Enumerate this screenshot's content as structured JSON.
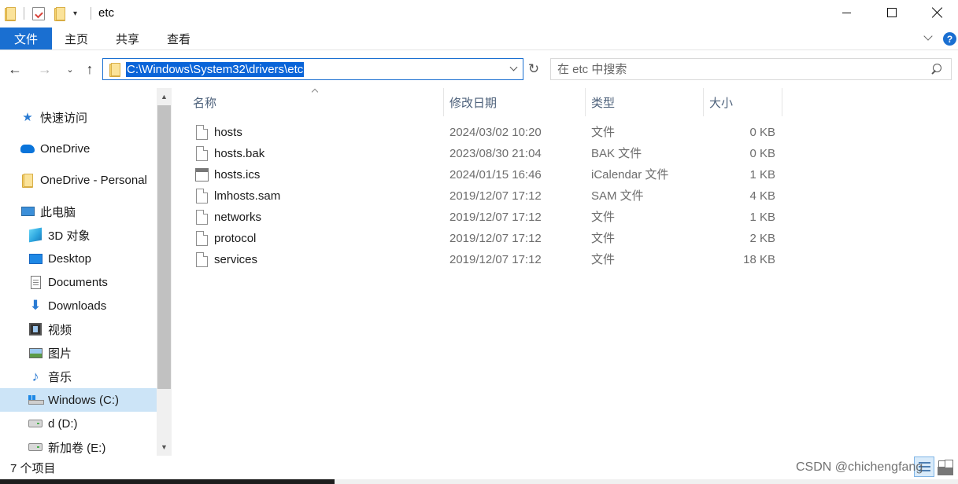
{
  "window": {
    "title": "etc",
    "qat_dropdown": "▾"
  },
  "ribbon": {
    "tabs": [
      "文件",
      "主页",
      "共享",
      "查看"
    ],
    "help": "?"
  },
  "address": {
    "path": "C:\\Windows\\System32\\drivers\\etc"
  },
  "search": {
    "placeholder": "在 etc 中搜索"
  },
  "nav": {
    "items": [
      {
        "label": "快速访问",
        "icon": "star-icon"
      },
      {
        "label": "OneDrive",
        "icon": "cloud-icon"
      },
      {
        "label": "OneDrive - Personal",
        "icon": "folder-icon"
      },
      {
        "label": "此电脑",
        "icon": "computer-icon"
      },
      {
        "label": "3D 对象",
        "icon": "cube-icon"
      },
      {
        "label": "Desktop",
        "icon": "desktop-icon"
      },
      {
        "label": "Documents",
        "icon": "document-icon"
      },
      {
        "label": "Downloads",
        "icon": "download-icon"
      },
      {
        "label": "视频",
        "icon": "video-icon"
      },
      {
        "label": "图片",
        "icon": "picture-icon"
      },
      {
        "label": "音乐",
        "icon": "music-icon"
      },
      {
        "label": "Windows (C:)",
        "icon": "windows-drive-icon",
        "selected": true
      },
      {
        "label": "d (D:)",
        "icon": "drive-icon"
      },
      {
        "label": "新加卷 (E:)",
        "icon": "drive-icon"
      }
    ]
  },
  "files": {
    "columns": [
      "名称",
      "修改日期",
      "类型",
      "大小"
    ],
    "rows": [
      {
        "name": "hosts",
        "date": "2024/03/02 10:20",
        "type": "文件",
        "size": "0 KB",
        "icon": "file-icon"
      },
      {
        "name": "hosts.bak",
        "date": "2023/08/30 21:04",
        "type": "BAK 文件",
        "size": "0 KB",
        "icon": "file-icon"
      },
      {
        "name": "hosts.ics",
        "date": "2024/01/15 16:46",
        "type": "iCalendar 文件",
        "size": "1 KB",
        "icon": "calendar-icon"
      },
      {
        "name": "lmhosts.sam",
        "date": "2019/12/07 17:12",
        "type": "SAM 文件",
        "size": "4 KB",
        "icon": "file-icon"
      },
      {
        "name": "networks",
        "date": "2019/12/07 17:12",
        "type": "文件",
        "size": "1 KB",
        "icon": "file-icon"
      },
      {
        "name": "protocol",
        "date": "2019/12/07 17:12",
        "type": "文件",
        "size": "2 KB",
        "icon": "file-icon"
      },
      {
        "name": "services",
        "date": "2019/12/07 17:12",
        "type": "文件",
        "size": "18 KB",
        "icon": "file-icon"
      }
    ]
  },
  "status": {
    "item_count": "7 个项目"
  },
  "watermark": "CSDN @chichengfang",
  "colors": {
    "accent": "#1a6fd1",
    "selection": "#0a64d8",
    "nav_selected": "#cce4f7"
  }
}
